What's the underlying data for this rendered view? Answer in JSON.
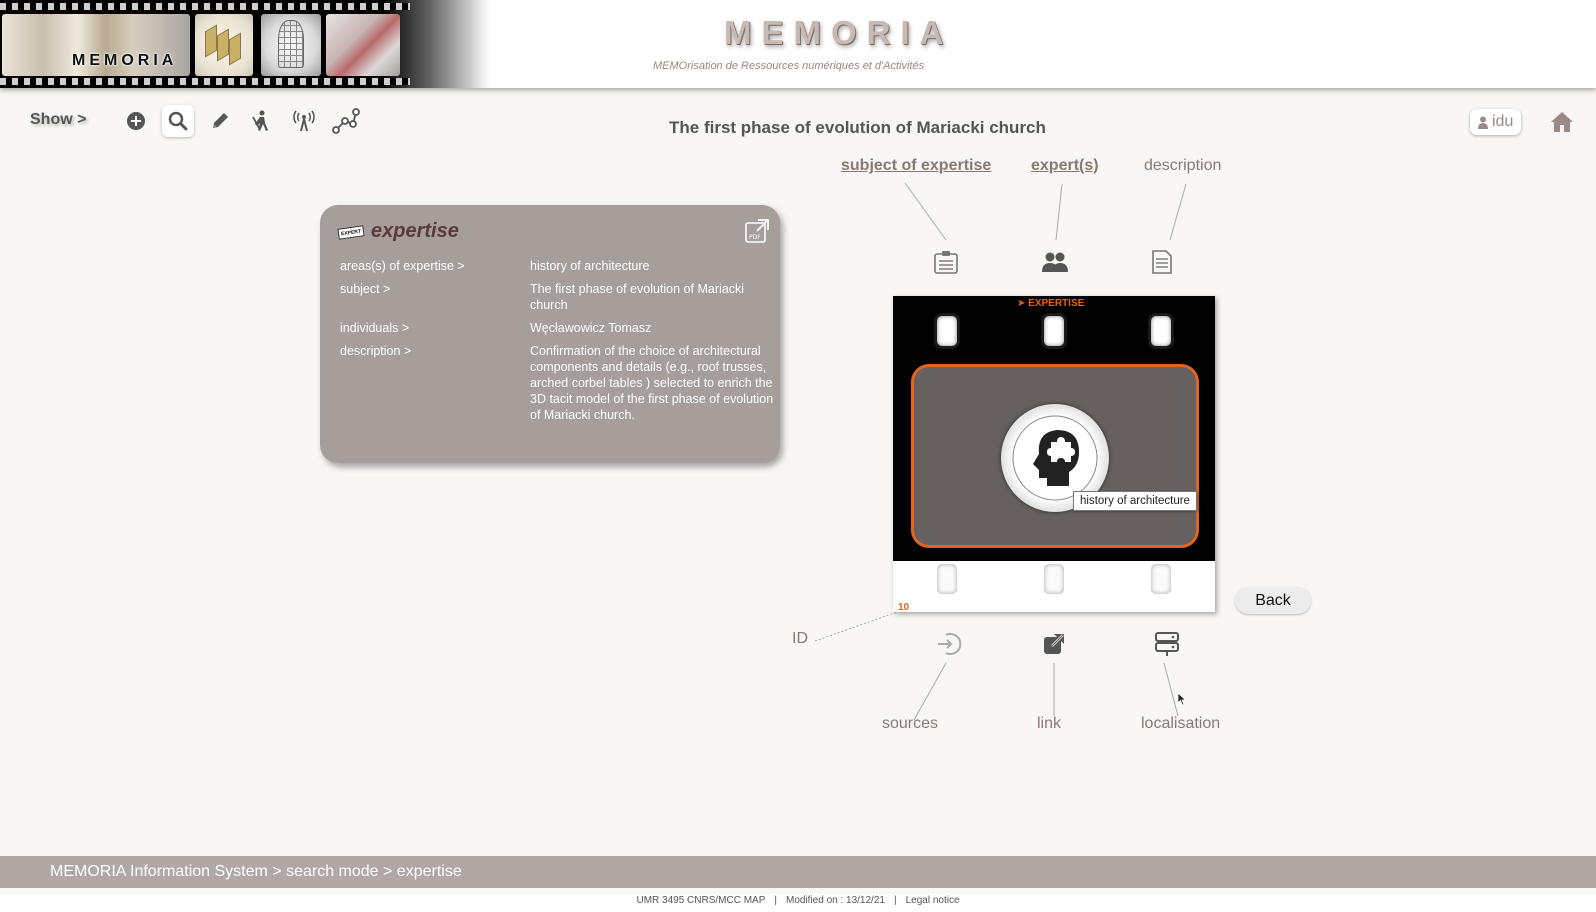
{
  "header": {
    "logo_text": "MEMORIA",
    "site_title": "MEMORIA",
    "site_subtitle": "MEMOrisation de Ressources numériques et d'Activités"
  },
  "toolbar": {
    "show_label": "Show >",
    "tools": [
      "add-icon",
      "search-icon",
      "pencil-icon",
      "worker-icon",
      "antenna-icon",
      "graph-icon"
    ],
    "active_tool": "search-icon"
  },
  "page": {
    "title": "The first phase of evolution of Mariacki church",
    "user_label": "idu"
  },
  "card": {
    "badge": "EXPERT",
    "title": "expertise",
    "rows": [
      {
        "label": "areas(s) of expertise >",
        "value": "history of architecture"
      },
      {
        "label": "subject >",
        "value": "The first phase of evolution of Mariacki church"
      },
      {
        "label": "individuals >",
        "value": "Węcławowicz Tomasz"
      },
      {
        "label": "description >",
        "value": "Confirmation of the choice of architectural components and details (e.g., roof trusses, arched corbel tables ) selected to enrich the 3D tacit model of the first phase of evolution of Mariacki church."
      }
    ]
  },
  "diagram": {
    "top_links": {
      "subject": "subject of expertise",
      "experts": "expert(s)",
      "description": "description"
    },
    "bottom_labels": {
      "id": "ID",
      "sources": "sources",
      "link": "link",
      "localisation": "localisation"
    },
    "film_tag": "➤ EXPERTISE",
    "film_id": "10",
    "tooltip": "history of architecture",
    "back_label": "Back",
    "accent_color": "#e0651e"
  },
  "footer": {
    "breadcrumb": "MEMORIA  Information System  >  search mode > expertise",
    "lab": "UMR 3495 CNRS/MCC MAP",
    "modified": "Modified on : 13/12/21",
    "legal": "Legal notice"
  }
}
